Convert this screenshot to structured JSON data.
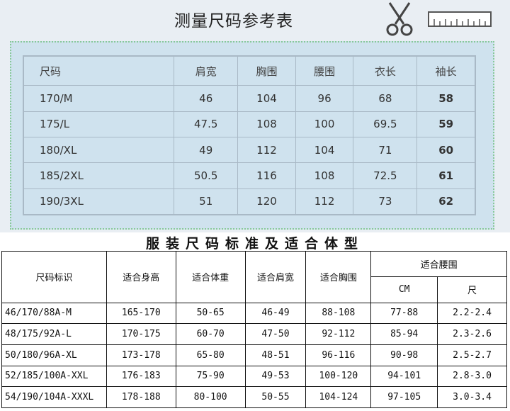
{
  "top": {
    "title": "测量尺码参考表",
    "headers": [
      "尺码",
      "肩宽",
      "胸围",
      "腰围",
      "衣长",
      "袖长"
    ],
    "rows": [
      [
        "170/M",
        "46",
        "104",
        "96",
        "68",
        "58"
      ],
      [
        "175/L",
        "47.5",
        "108",
        "100",
        "69.5",
        "59"
      ],
      [
        "180/XL",
        "49",
        "112",
        "104",
        "71",
        "60"
      ],
      [
        "185/2XL",
        "50.5",
        "116",
        "108",
        "72.5",
        "61"
      ],
      [
        "190/3XL",
        "51",
        "120",
        "112",
        "73",
        "62"
      ]
    ],
    "icons": [
      "scissors-icon",
      "ruler-icon"
    ],
    "colors": {
      "background": "#e9eef3",
      "panel": "#cfe2ee",
      "dotted_border": "#88c999"
    }
  },
  "bottom": {
    "title": "服装尺码标准及适合体型",
    "headers": [
      "尺码标识",
      "适合身高",
      "适合体重",
      "适合肩宽",
      "适合胸围",
      "适合腰围"
    ],
    "waist_sub": [
      "CM",
      "尺"
    ],
    "rows": [
      [
        "46/170/88A-M",
        "165-170",
        "50-65",
        "46-49",
        "88-108",
        "77-88",
        "2.2-2.4"
      ],
      [
        "48/175/92A-L",
        "170-175",
        "60-70",
        "47-50",
        "92-112",
        "85-94",
        "2.3-2.6"
      ],
      [
        "50/180/96A-XL",
        "173-178",
        "65-80",
        "48-51",
        "96-116",
        "90-98",
        "2.5-2.7"
      ],
      [
        "52/185/100A-XXL",
        "176-183",
        "75-90",
        "49-53",
        "100-120",
        "94-101",
        "2.8-3.0"
      ],
      [
        "54/190/104A-XXXL",
        "178-188",
        "80-100",
        "50-55",
        "104-124",
        "97-105",
        "3.0-3.4"
      ]
    ]
  }
}
